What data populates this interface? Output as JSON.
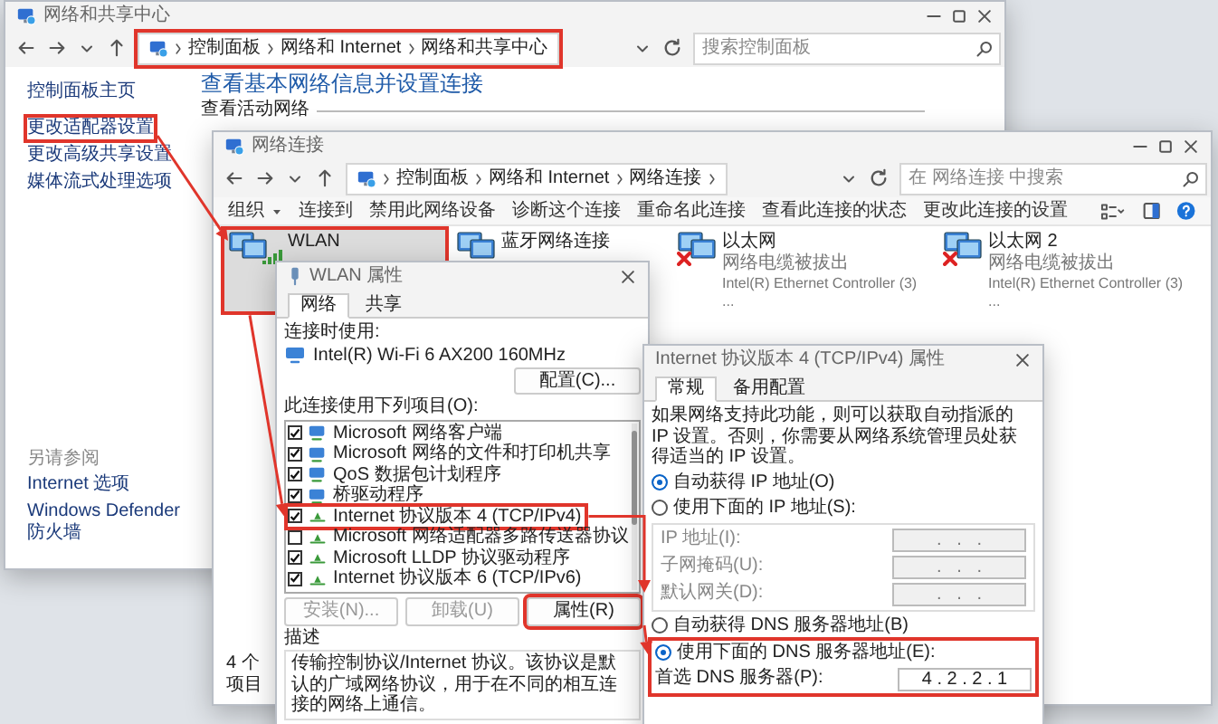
{
  "sharing_center": {
    "title": "网络和共享中心",
    "address_bar": {
      "highlighted": true,
      "crumbs": [
        "控制面板",
        "网络和 Internet",
        "网络和共享中心"
      ]
    },
    "search_placeholder": "搜索控制面板",
    "sidebar": {
      "links": [
        {
          "label": "控制面板主页",
          "highlighted": false
        },
        {
          "label": "更改适配器设置",
          "highlighted": true
        },
        {
          "label": "更改高级共享设置",
          "highlighted": false
        },
        {
          "label": "媒体流式处理选项",
          "highlighted": false
        }
      ],
      "see_also_title": "另请参阅",
      "see_also": [
        "Internet 选项",
        "Windows Defender 防火墙"
      ]
    },
    "heading": "查看基本网络信息并设置连接",
    "section": "查看活动网络"
  },
  "network_connections": {
    "title": "网络连接",
    "crumbs": [
      "控制面板",
      "网络和 Internet",
      "网络连接"
    ],
    "search_placeholder": "在 网络连接 中搜索",
    "toolbar": [
      "组织",
      "连接到",
      "禁用此网络设备",
      "诊断这个连接",
      "重命名此连接",
      "查看此连接的状态",
      "更改此连接的设置"
    ],
    "adapters": [
      {
        "kind": "wifi",
        "name": "WLAN",
        "selected": true,
        "highlighted": true,
        "disconnected": false
      },
      {
        "kind": "bluetooth",
        "name": "蓝牙网络连接",
        "selected": false,
        "highlighted": false,
        "disconnected": false
      },
      {
        "kind": "ethernet",
        "name": "以太网",
        "status": "网络电缆被拔出",
        "device": "Intel(R) Ethernet Controller (3) ...",
        "selected": false,
        "highlighted": false,
        "disconnected": true
      },
      {
        "kind": "ethernet",
        "name": "以太网 2",
        "status": "网络电缆被拔出",
        "device": "Intel(R) Ethernet Controller (3) ...",
        "selected": false,
        "highlighted": false,
        "disconnected": true
      }
    ],
    "status_bar": "4 个项目"
  },
  "wlan_properties": {
    "title": "WLAN 属性",
    "tabs": [
      {
        "label": "网络",
        "selected": true
      },
      {
        "label": "共享",
        "selected": false
      }
    ],
    "connect_using_label": "连接时使用:",
    "device": "Intel(R) Wi-Fi 6 AX200 160MHz",
    "configure_button": "配置(C)...",
    "items_label": "此连接使用下列项目(O):",
    "items": [
      {
        "kind": "component",
        "label": "Microsoft 网络客户端",
        "checked": true,
        "highlighted": false
      },
      {
        "kind": "component",
        "label": "Microsoft 网络的文件和打印机共享",
        "checked": true,
        "highlighted": false
      },
      {
        "kind": "component",
        "label": "QoS 数据包计划程序",
        "checked": true,
        "highlighted": false
      },
      {
        "kind": "component",
        "label": "桥驱动程序",
        "checked": true,
        "highlighted": false
      },
      {
        "kind": "protocol",
        "label": "Internet 协议版本 4 (TCP/IPv4)",
        "checked": true,
        "highlighted": true
      },
      {
        "kind": "protocol",
        "label": "Microsoft 网络适配器多路传送器协议",
        "checked": false,
        "highlighted": false
      },
      {
        "kind": "protocol",
        "label": "Microsoft LLDP 协议驱动程序",
        "checked": true,
        "highlighted": false
      },
      {
        "kind": "protocol",
        "label": "Internet 协议版本 6 (TCP/IPv6)",
        "checked": true,
        "highlighted": false
      }
    ],
    "buttons": [
      {
        "label": "安装(N)...",
        "disabled": true,
        "highlighted": false
      },
      {
        "label": "卸载(U)",
        "disabled": true,
        "highlighted": false
      },
      {
        "label": "属性(R)",
        "disabled": false,
        "highlighted": true
      }
    ],
    "description_title": "描述",
    "description": "传输控制协议/Internet 协议。该协议是默认的广域网络协议，用于在不同的相互连接的网络上通信。"
  },
  "ipv4_properties": {
    "title": "Internet 协议版本 4 (TCP/IPv4) 属性",
    "tabs": [
      {
        "label": "常规",
        "selected": true
      },
      {
        "label": "备用配置",
        "selected": false
      }
    ],
    "intro": "如果网络支持此功能，则可以获取自动指派的 IP 设置。否则，你需要从网络系统管理员处获得适当的 IP 设置。",
    "ip_options": [
      {
        "label": "自动获得 IP 地址(O)",
        "selected": true
      },
      {
        "label": "使用下面的 IP 地址(S):",
        "selected": false
      }
    ],
    "ip_fields": [
      {
        "label": "IP 地址(I):",
        "placeholder": ".   .   .",
        "disabled": true
      },
      {
        "label": "子网掩码(U):",
        "placeholder": ".   .   .",
        "disabled": true
      },
      {
        "label": "默认网关(D):",
        "placeholder": ".   .   .",
        "disabled": true
      }
    ],
    "dns_options": [
      {
        "label": "自动获得 DNS 服务器地址(B)",
        "selected": false,
        "highlighted": false
      },
      {
        "label": "使用下面的 DNS 服务器地址(E):",
        "selected": true,
        "highlighted": true
      }
    ],
    "dns_fields": [
      {
        "label": "首选 DNS 服务器(P):",
        "value": "4 . 2 . 2 . 1",
        "disabled": false
      }
    ]
  }
}
